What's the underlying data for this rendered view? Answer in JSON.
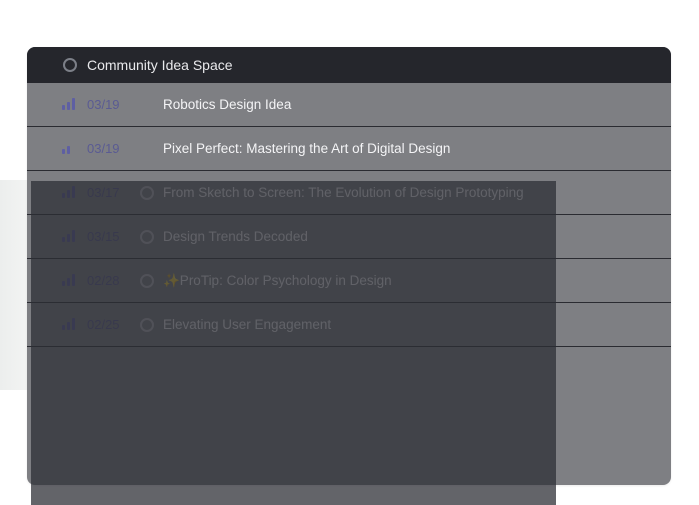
{
  "header": {
    "title": "Community Idea Space",
    "icon": "status-circle-icon"
  },
  "rows": [
    {
      "date": "03/19",
      "title": "Robotics Design Idea",
      "priority_icon": "bar-chart-icon",
      "circle_visible": false
    },
    {
      "date": "03/19",
      "title": "Pixel Perfect: Mastering the Art of Digital Design",
      "priority_icon": "bar-chart-icon",
      "circle_visible": false
    },
    {
      "date": "03/17",
      "title": "From Sketch to Screen: The Evolution of Design Prototyping",
      "priority_icon": "bar-chart-icon",
      "circle_visible": true
    },
    {
      "date": "03/15",
      "title": "Design Trends Decoded",
      "priority_icon": "bar-chart-icon",
      "circle_visible": true
    },
    {
      "date": "02/28",
      "title": "✨ProTip: Color Psychology in Design",
      "priority_icon": "bar-chart-icon",
      "circle_visible": true
    },
    {
      "date": "02/25",
      "title": "Elevating User Engagement",
      "priority_icon": "bar-chart-icon",
      "circle_visible": true
    }
  ],
  "colors": {
    "header_bg": "#25262c",
    "list_bg": "#7e7f83",
    "accent": "#5e5fa3",
    "overlay": "#2d2e34"
  }
}
